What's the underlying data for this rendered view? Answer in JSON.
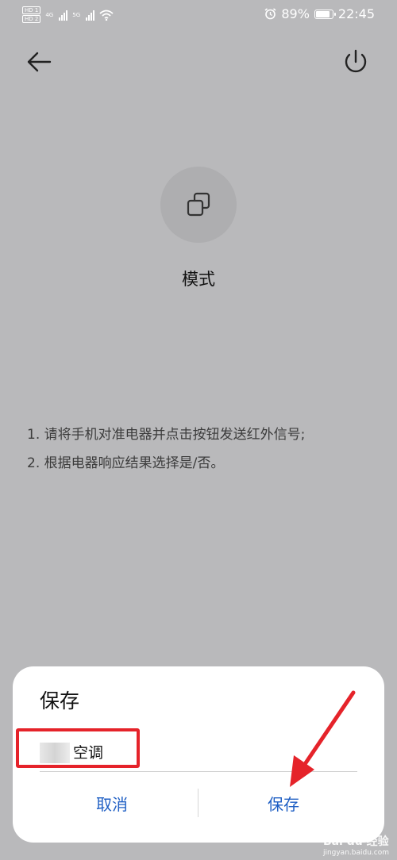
{
  "statusbar": {
    "left_badges": [
      "HD 1",
      "HD 2"
    ],
    "network1": "4G",
    "network2": "5G",
    "battery_pct": "89%",
    "battery_level": 0.89,
    "time": "22:45"
  },
  "main": {
    "mode_label": "模式",
    "instructions": [
      "1. 请将手机对准电器并点击按钮发送红外信号;",
      "2. 根据电器响应结果选择是/否。"
    ]
  },
  "dialog": {
    "title": "保存",
    "name_value": "空调",
    "cancel_label": "取消",
    "save_label": "保存"
  },
  "colors": {
    "background": "#b9b9bb",
    "accent": "#1f5fc4",
    "annotation": "#e5232a"
  },
  "watermark": {
    "brand": "Bai du 经验",
    "url": "jingyan.baidu.com"
  }
}
